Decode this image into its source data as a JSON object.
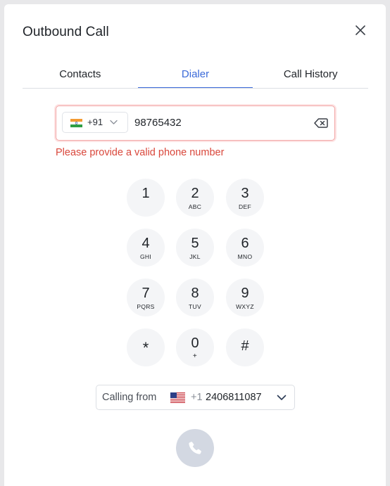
{
  "dialog": {
    "title": "Outbound Call"
  },
  "tabs": [
    {
      "label": "Contacts",
      "active": false
    },
    {
      "label": "Dialer",
      "active": true
    },
    {
      "label": "Call History",
      "active": false
    }
  ],
  "phone": {
    "country_code": "+91",
    "country_flag": "india-flag-icon",
    "value": "98765432",
    "error": "Please provide a valid phone number"
  },
  "keypad": [
    {
      "digit": "1",
      "letters": ""
    },
    {
      "digit": "2",
      "letters": "ABC"
    },
    {
      "digit": "3",
      "letters": "DEF"
    },
    {
      "digit": "4",
      "letters": "GHI"
    },
    {
      "digit": "5",
      "letters": "JKL"
    },
    {
      "digit": "6",
      "letters": "MNO"
    },
    {
      "digit": "7",
      "letters": "PQRS"
    },
    {
      "digit": "8",
      "letters": "TUV"
    },
    {
      "digit": "9",
      "letters": "WXYZ"
    },
    {
      "digit": "*",
      "letters": ""
    },
    {
      "digit": "0",
      "letters": "+"
    },
    {
      "digit": "#",
      "letters": ""
    }
  ],
  "calling_from": {
    "label": "Calling from",
    "flag": "usa-flag-icon",
    "code": "+1",
    "number": "2406811087"
  },
  "colors": {
    "accent": "#3b6ad9",
    "error": "#d9473b",
    "key_bg": "#f4f5f7",
    "call_button_disabled": "#d3d8e2"
  }
}
